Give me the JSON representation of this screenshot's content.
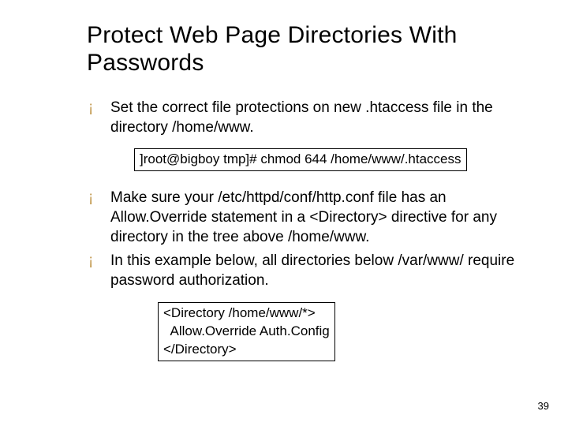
{
  "title": "Protect Web Page Directories With Passwords",
  "bullets": {
    "b1": "Set the correct file protections on new .htaccess file in the directory /home/www.",
    "b2": "Make sure your /etc/httpd/conf/http.conf file has an Allow.Override statement in a <Directory> directive for any directory in the tree above /home/www.",
    "b3": "In this example below, all directories below /var/www/ require password authorization."
  },
  "code1": "]root@bigboy tmp]# chmod 644 /home/www/.htaccess",
  "code2": "<Directory /home/www/*>\n  Allow.Override Auth.Config\n</Directory>",
  "page_number": "39"
}
